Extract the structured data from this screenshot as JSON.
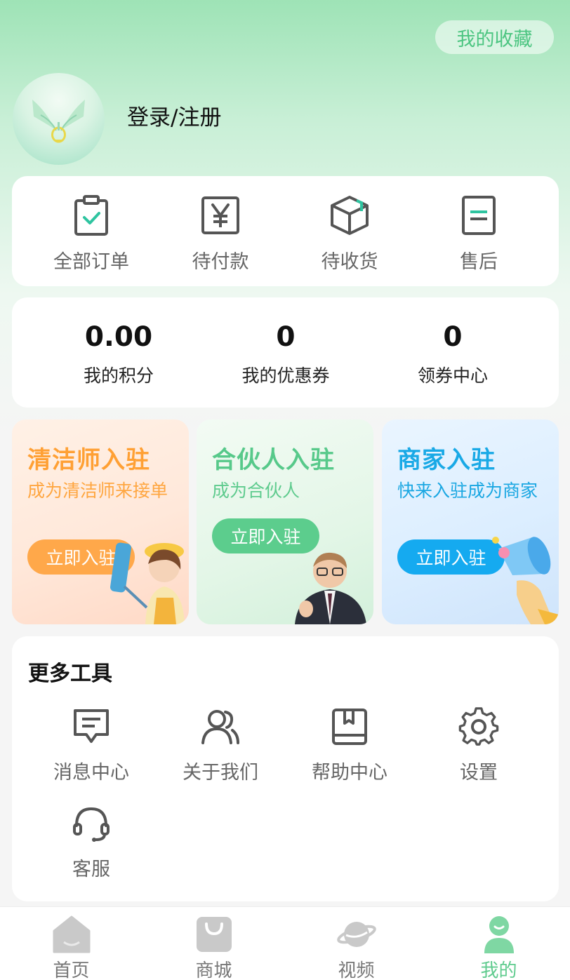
{
  "header": {
    "favorites_label": "我的收藏",
    "login_label": "登录/注册"
  },
  "orders": [
    {
      "label": "全部订单",
      "icon": "clipboard-check-icon"
    },
    {
      "label": "待付款",
      "icon": "yen-icon"
    },
    {
      "label": "待收货",
      "icon": "package-icon"
    },
    {
      "label": "售后",
      "icon": "document-icon"
    }
  ],
  "stats": [
    {
      "value": "0.00",
      "label": "我的积分"
    },
    {
      "value": "0",
      "label": "我的优惠券"
    },
    {
      "value": "0",
      "label": "领券中心"
    }
  ],
  "promos": [
    {
      "title": "清洁师入驻",
      "desc": "成为清洁师来接单",
      "button": "立即入驻",
      "color": "#ffa034"
    },
    {
      "title": "合伙人入驻",
      "desc": "成为合伙人",
      "button": "立即入驻",
      "color": "#57c98a"
    },
    {
      "title": "商家入驻",
      "desc": "快来入驻成为商家",
      "button": "立即入驻",
      "color": "#19a9e6"
    }
  ],
  "tools": {
    "title": "更多工具",
    "items": [
      {
        "label": "消息中心",
        "icon": "message-icon"
      },
      {
        "label": "关于我们",
        "icon": "users-icon"
      },
      {
        "label": "帮助中心",
        "icon": "book-icon"
      },
      {
        "label": "设置",
        "icon": "gear-icon"
      },
      {
        "label": "客服",
        "icon": "headset-icon"
      }
    ]
  },
  "tabbar": [
    {
      "label": "首页",
      "icon": "home-icon"
    },
    {
      "label": "商城",
      "icon": "shopping-bag-icon"
    },
    {
      "label": "视频",
      "icon": "planet-icon"
    },
    {
      "label": "我的",
      "icon": "user-icon",
      "active": true
    }
  ],
  "colors": {
    "accent": "#5fcb8e",
    "icon_gray": "#555555"
  }
}
